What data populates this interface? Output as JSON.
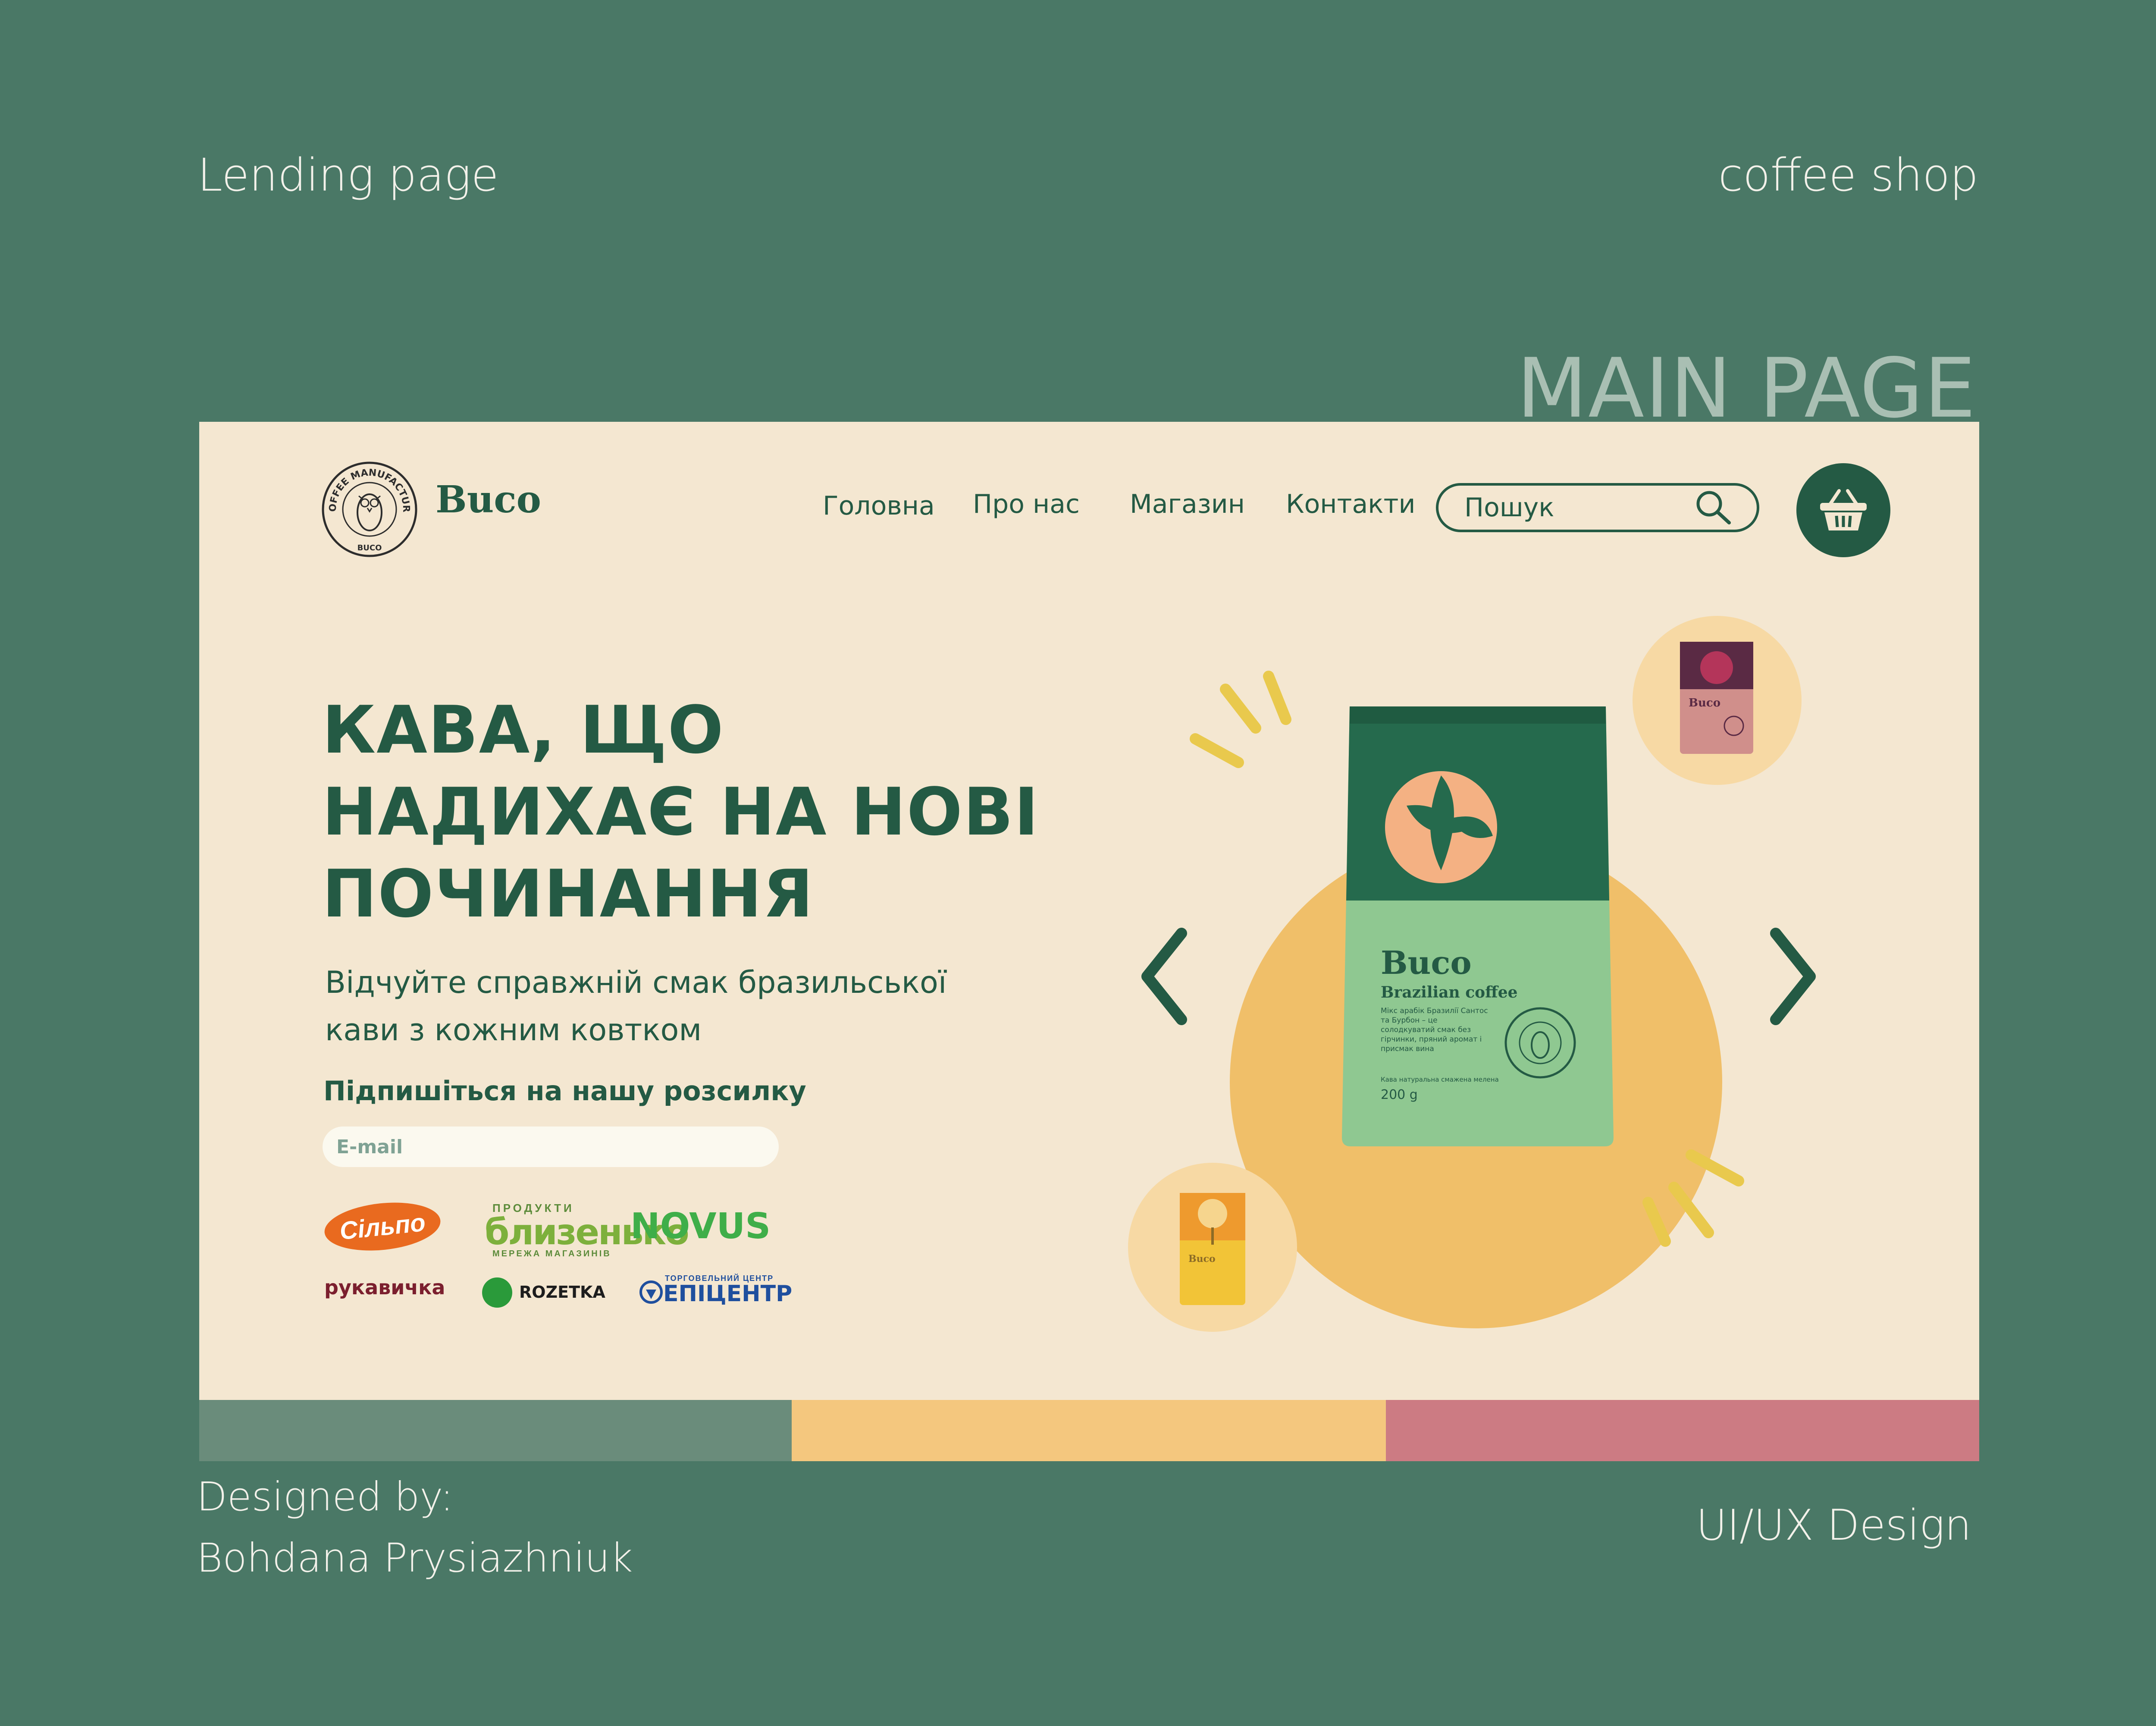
{
  "presentation": {
    "left_title": "Lending page",
    "right_title": "coffee shop",
    "section_title": "MAIN PAGE",
    "designed_by_label": "Designed by:",
    "designer_name": "Bohdana Prysiazhniuk",
    "discipline": "UI/UX Design"
  },
  "header": {
    "brand": "Buco",
    "logo_ring_text": "COFFEE MANUFACTURE",
    "logo_bottom_text": "BUCO",
    "nav": [
      "Головна",
      "Про нас",
      "Магазин",
      "Контакти"
    ],
    "search_placeholder": "Пошук"
  },
  "hero": {
    "headline_lines": [
      "КАВА, ЩО",
      "НАДИХАЄ НА НОВІ",
      "ПОЧИНАННЯ"
    ],
    "subtext_lines": [
      "Відчуйте справжній смак бразильської",
      "кави з кожним ковтком"
    ],
    "subscribe_label": "Підпишіться на нашу розсилку",
    "email_placeholder": "E-mail"
  },
  "partners": {
    "silpo": "Сільпо",
    "blyzenko_top": "ПРОДУКТИ",
    "blyzenko": "близенько",
    "blyzenko_bottom": "МЕРЕЖА МАГАЗИНІВ",
    "novus": "NOVUS",
    "rukavychka": "рукавичка",
    "rozetka": "ROZETKA",
    "epicentr_top": "ТОРГОВЕЛЬНИЙ ЦЕНТР",
    "epicentr": "ЕПІЦЕНТР"
  },
  "product": {
    "brand": "Buco",
    "name": "Brazilian coffee",
    "description": "Мікс арабік Бразилії Сантос та Бурбон – це солодкуватий смак без гірчинки, пряний аромат і присмак вина",
    "type": "Кава натуральна смажена мелена",
    "weight": "200 g"
  },
  "colors": {
    "page_bg": "#4a7866",
    "frame_bg": "#f4e7d1",
    "brand_green": "#245a44",
    "accent_yellow": "#f0bf69",
    "strip_green": "#6a8c7b",
    "strip_yellow": "#f4c77e",
    "strip_pink": "#cc7b83"
  },
  "icons": {
    "search": "search-icon",
    "cart": "basket-icon",
    "prev": "chevron-left-icon",
    "next": "chevron-right-icon"
  }
}
